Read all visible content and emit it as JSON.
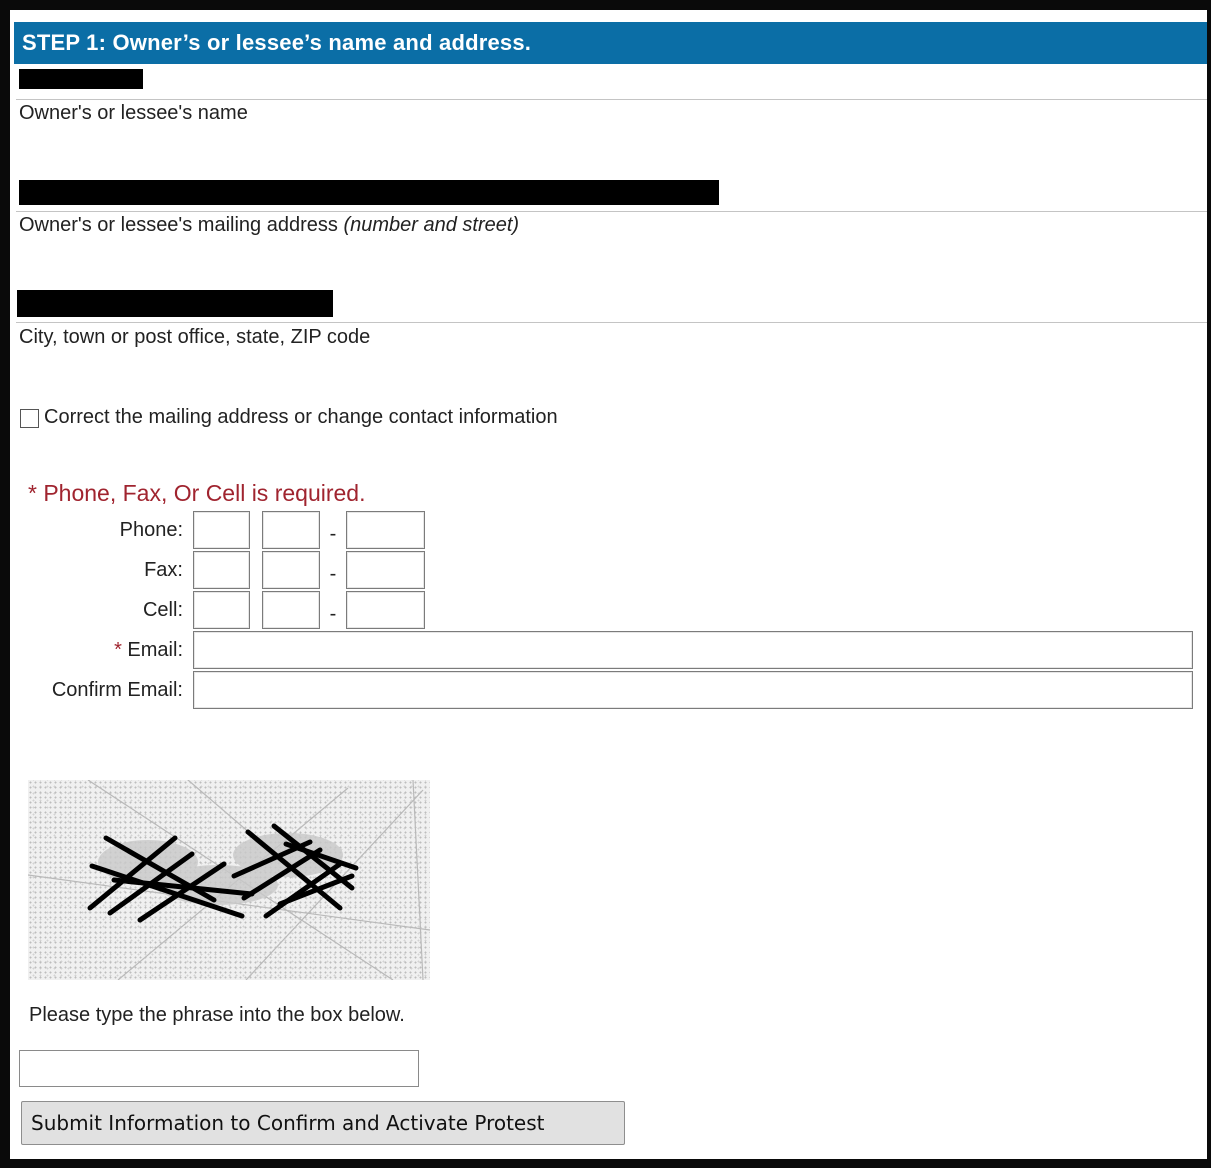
{
  "step": {
    "title": "STEP 1: Owner’s or lessee’s name and address."
  },
  "owner": {
    "name_label": "Owner's or lessee's name",
    "mailing_label": "Owner's or lessee's mailing address",
    "mailing_label_hint": "(number and street)",
    "city_label": "City, town or post office, state, ZIP code"
  },
  "correction": {
    "checkbox_label": "Correct the mailing address or change contact information",
    "checked": false
  },
  "contact": {
    "required_message": "* Phone, Fax, Or Cell is required.",
    "phone_label": "Phone:",
    "fax_label": "Fax:",
    "cell_label": "Cell:",
    "separator": "-",
    "email_star": "*",
    "email_label": " Email:",
    "confirm_email_label": "Confirm Email:"
  },
  "captcha": {
    "instruction": "Please type the phrase into the box below.",
    "input_value": ""
  },
  "actions": {
    "submit_label": "Submit Information to Confirm and Activate Protest"
  },
  "colors": {
    "header_bg": "#0b6ea6",
    "required_red": "#a0242f",
    "redaction": "#000000"
  }
}
